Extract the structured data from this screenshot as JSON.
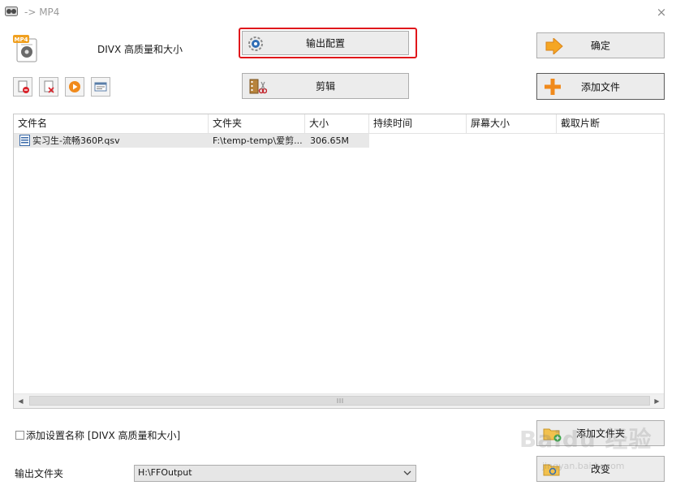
{
  "window": {
    "title": "-> MP4",
    "close_glyph": "×"
  },
  "format": {
    "badge": "MP4",
    "label": "DIVX 高质量和大小"
  },
  "buttons": {
    "output_config": "输出配置",
    "ok": "确定",
    "clip": "剪辑",
    "add_file": "添加文件",
    "add_folder": "添加文件夹",
    "change": "改变"
  },
  "toolbar": [
    "remove-file-icon",
    "clear-list-icon",
    "play-icon",
    "media-info-icon"
  ],
  "table": {
    "columns": [
      "文件名",
      "文件夹",
      "大小",
      "持续时间",
      "屏幕大小",
      "截取片断"
    ],
    "rows": [
      {
        "name": "实习生-流畅360P.qsv",
        "folder": "F:\\temp-temp\\爱剪...",
        "size": "306.65M",
        "duration": "",
        "screen": "",
        "clip": ""
      }
    ]
  },
  "options": {
    "add_setting_name_label": "添加设置名称 [DIVX 高质量和大小]",
    "add_setting_name_checked": false,
    "output_folder_label": "输出文件夹",
    "output_folder_value": "H:\\FFOutput"
  },
  "watermark": {
    "text": "Baidu 经验",
    "sub": "jingyan.baidu.com"
  },
  "colors": {
    "highlight": "#e0161b",
    "add_icon": "#f08a1c",
    "ok_arrow": "#f5a623",
    "accent_blue": "#2f6db5"
  }
}
